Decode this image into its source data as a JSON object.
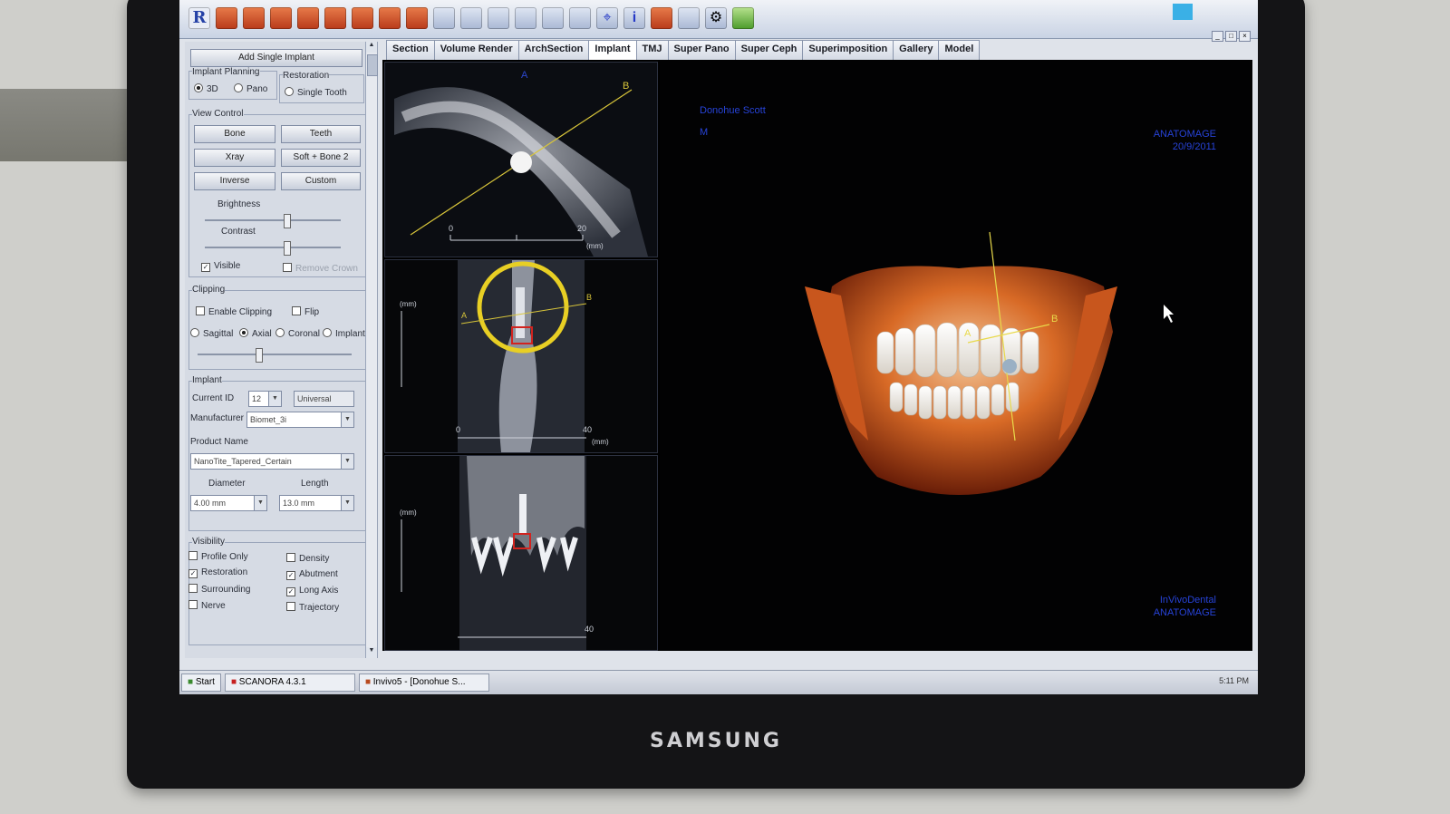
{
  "toolbar": {
    "icons": [
      "r-logo-icon",
      "tooth-icon",
      "tooth-icon",
      "tooth-icon",
      "tooth-icon",
      "tooth-icon",
      "crown-icon",
      "tooth-icon",
      "tooth-icon",
      "ruler-icon",
      "angle-icon",
      "probe-icon",
      "grid-icon",
      "pencil-icon",
      "grid-icon",
      "crosshair-icon",
      "info-icon",
      "bell-icon",
      "implant-icon",
      "gear-icon",
      "marker-icon"
    ]
  },
  "left": {
    "add_implant": "Add Single Implant",
    "implant_planning": "Implant Planning",
    "opt_3d": "3D",
    "opt_pano": "Pano",
    "restoration": "Restoration",
    "single_tooth": "Single Tooth",
    "view_control": "View Control",
    "btn_bone": "Bone",
    "btn_teeth": "Teeth",
    "btn_xray": "Xray",
    "btn_soft_bone": "Soft + Bone 2",
    "btn_inverse": "Inverse",
    "btn_custom": "Custom",
    "brightness": "Brightness",
    "contrast": "Contrast",
    "brightness_level": 0.6,
    "contrast_level": 0.6,
    "visible": "Visible",
    "remove_crown": "Remove Crown",
    "clipping": "Clipping",
    "enable_clipping": "Enable Clipping",
    "flip": "Flip",
    "sagittal": "Sagittal",
    "axial": "Axial",
    "coronal": "Coronal",
    "implant_opt": "Implant",
    "implant_group": "Implant",
    "current_id_label": "Current ID",
    "current_id": "12",
    "universal": "Universal",
    "manufacturer_label": "Manufacturer",
    "manufacturer": "Biomet_3i",
    "product_label": "Product Name",
    "product": "NanoTite_Tapered_Certain",
    "diameter_label": "Diameter",
    "diameter": "4.00 mm",
    "length_label": "Length",
    "length": "13.0 mm",
    "visibility": "Visibility",
    "profile_only": "Profile Only",
    "density": "Density",
    "restoration_chk": "Restoration",
    "abutment": "Abutment",
    "surrounding": "Surrounding",
    "long_axis": "Long Axis",
    "nerve": "Nerve",
    "trajectory": "Trajectory"
  },
  "tabs": [
    "Section",
    "Volume Render",
    "ArchSection",
    "Implant",
    "TMJ",
    "Super Pano",
    "Super Ceph",
    "Superimposition",
    "Gallery",
    "Model"
  ],
  "views": {
    "axial_a": "A",
    "axial_b": "B",
    "scale_0": "0",
    "scale_20": "20",
    "scale_40": "40",
    "mm": "(mm)",
    "overlay_name": "Donohue Scott",
    "overlay_m": "M",
    "overlay_brand": "ANATOMAGE",
    "overlay_date": "20/9/2011",
    "footer_1": "InVivoDental",
    "footer_2": "ANATOMAGE"
  },
  "taskbar": {
    "start": "Start",
    "app1": "SCANORA 4.3.1",
    "app2": "Invivo5 - [Donohue S...",
    "clock": "5:11 PM"
  },
  "monitor_brand": "SAMSUNG"
}
